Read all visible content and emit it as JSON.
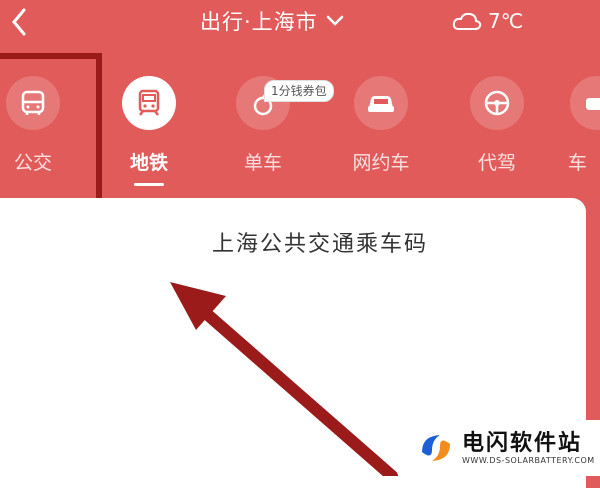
{
  "header": {
    "title": "出行·上海市",
    "weather_temp": "7℃"
  },
  "modes": [
    {
      "id": "bus",
      "label": "公交",
      "icon": "bus-icon"
    },
    {
      "id": "metro",
      "label": "地铁",
      "icon": "metro-icon",
      "active": true
    },
    {
      "id": "bike",
      "label": "单车",
      "icon": "bike-icon"
    },
    {
      "id": "ridehail",
      "label": "网约车",
      "icon": "car-icon"
    },
    {
      "id": "driver",
      "label": "代驾",
      "icon": "steering-wheel-icon"
    },
    {
      "id": "more",
      "label": "车",
      "icon": "car-icon"
    }
  ],
  "badge": "1分钱券包",
  "card": {
    "title": "上海公共交通乘车码"
  },
  "watermark": {
    "name": "电闪软件站",
    "url": "WWW.DS-SOLARBATTERY.COM"
  },
  "colors": {
    "brand_red": "#e25b5b",
    "annotation_red": "#9b1a1a",
    "card_bg": "#ffffff"
  }
}
